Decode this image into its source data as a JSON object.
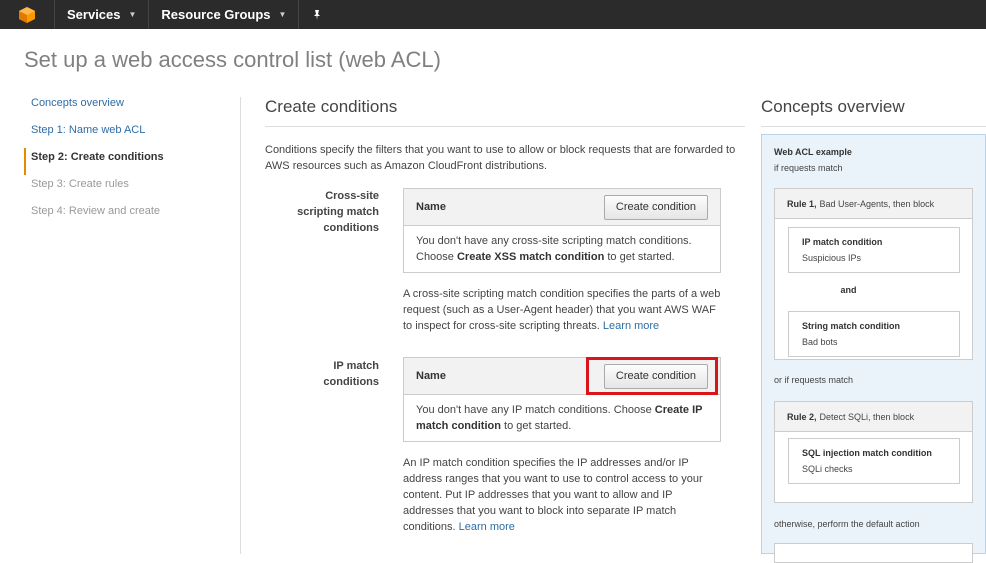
{
  "topnav": {
    "services_label": "Services",
    "resource_groups_label": "Resource Groups"
  },
  "page_title": "Set up a web access control list (web ACL)",
  "leftnav": {
    "items": [
      {
        "label": "Concepts overview"
      },
      {
        "label": "Step 1: Name web ACL"
      },
      {
        "label": "Step 2: Create conditions"
      },
      {
        "label": "Step 3: Create rules"
      },
      {
        "label": "Step 4: Review and create"
      }
    ]
  },
  "main": {
    "heading": "Create conditions",
    "intro": "Conditions specify the filters that you want to use to allow or block requests that are forwarded to AWS resources such as Amazon CloudFront distributions.",
    "xss": {
      "label_line1": "Cross-site",
      "label_line2": "scripting match",
      "label_line3": "conditions",
      "col_header": "Name",
      "button": "Create condition",
      "empty_pre": "You don't have any cross-site scripting match conditions. Choose ",
      "empty_bold": "Create XSS match condition",
      "empty_post": " to get started.",
      "desc": "A cross-site scripting match condition specifies the parts of a web request (such as a User-Agent header) that you want AWS WAF to inspect for cross-site scripting threats. ",
      "learn_more": "Learn more"
    },
    "ip": {
      "label_line1": "IP match",
      "label_line2": "conditions",
      "col_header": "Name",
      "button": "Create condition",
      "empty_pre": "You don't have any IP match conditions. Choose ",
      "empty_bold": "Create IP match condition",
      "empty_post": " to get started.",
      "desc": "An IP match condition specifies the IP addresses and/or IP address ranges that you want to use to control access to your content. Put IP addresses that you want to allow and IP addresses that you want to block into separate IP match conditions. ",
      "learn_more": "Learn more"
    }
  },
  "concepts": {
    "title": "Concepts overview",
    "example_title": "Web ACL example",
    "if_match": "if requests match",
    "rule1_bold": "Rule 1,",
    "rule1_rest": "Bad User-Agents, then block",
    "rule1_cond1_name": "IP match condition",
    "rule1_cond1_value": "Suspicious IPs",
    "and": "and",
    "rule1_cond2_name": "String match condition",
    "rule1_cond2_value": "Bad bots",
    "or_if_match": "or if requests match",
    "rule2_bold": "Rule 2,",
    "rule2_rest": "Detect SQLi, then block",
    "rule2_cond1_name": "SQL injection match condition",
    "rule2_cond1_value": "SQLi checks",
    "otherwise": "otherwise, perform the default action"
  },
  "colors": {
    "highlight": "#d9141b",
    "active_step_marker": "#e68a00",
    "link": "#2e6da4",
    "concepts_bg": "#eaf3fa"
  }
}
